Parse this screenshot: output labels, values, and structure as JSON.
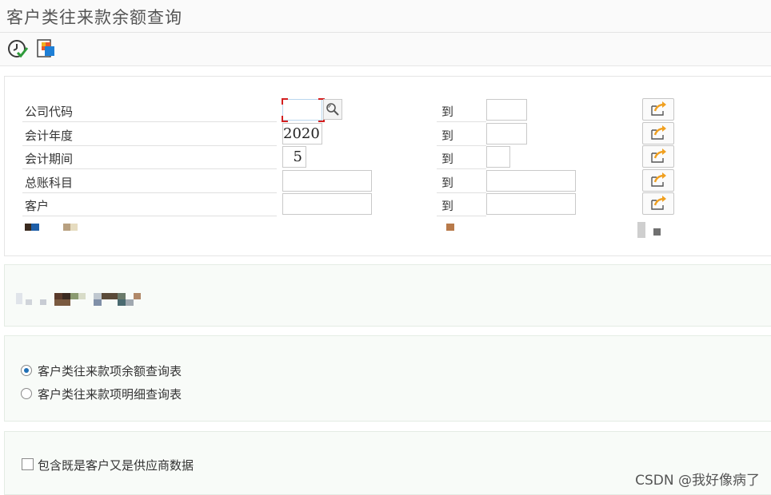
{
  "window": {
    "title": "客户类往来款余额查询"
  },
  "toolbar": {
    "execute_icon": "execute-clock-check-icon",
    "variant_icon": "get-variant-icon"
  },
  "selection": {
    "to_label": "到",
    "rows": [
      {
        "label": "公司代码",
        "from_value": "",
        "to_value": ""
      },
      {
        "label": "会计年度",
        "from_value": "2020",
        "to_value": ""
      },
      {
        "label": "会计期间",
        "from_value": "5",
        "to_value": ""
      },
      {
        "label": "总账科目",
        "from_value": "",
        "to_value": ""
      },
      {
        "label": "客户",
        "from_value": "",
        "to_value": ""
      }
    ],
    "multi_select_icon": "multiple-selection-arrow-icon",
    "search_help_icon": "search-help-icon"
  },
  "report_type": {
    "options": [
      {
        "label": "客户类往来款项余额查询表",
        "selected": true
      },
      {
        "label": "客户类往来款项明细查询表",
        "selected": false
      }
    ]
  },
  "options": {
    "include_vendor_label": "包含既是客户又是供应商数据",
    "include_vendor_checked": false
  },
  "watermark": "CSDN @我好像病了"
}
